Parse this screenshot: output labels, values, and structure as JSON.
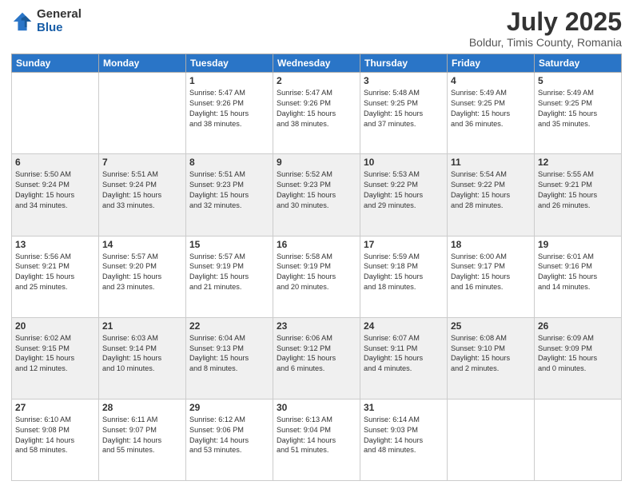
{
  "logo": {
    "general": "General",
    "blue": "Blue"
  },
  "title": "July 2025",
  "subtitle": "Boldur, Timis County, Romania",
  "weekdays": [
    "Sunday",
    "Monday",
    "Tuesday",
    "Wednesday",
    "Thursday",
    "Friday",
    "Saturday"
  ],
  "weeks": [
    [
      {
        "day": "",
        "info": ""
      },
      {
        "day": "",
        "info": ""
      },
      {
        "day": "1",
        "info": "Sunrise: 5:47 AM\nSunset: 9:26 PM\nDaylight: 15 hours\nand 38 minutes."
      },
      {
        "day": "2",
        "info": "Sunrise: 5:47 AM\nSunset: 9:26 PM\nDaylight: 15 hours\nand 38 minutes."
      },
      {
        "day": "3",
        "info": "Sunrise: 5:48 AM\nSunset: 9:25 PM\nDaylight: 15 hours\nand 37 minutes."
      },
      {
        "day": "4",
        "info": "Sunrise: 5:49 AM\nSunset: 9:25 PM\nDaylight: 15 hours\nand 36 minutes."
      },
      {
        "day": "5",
        "info": "Sunrise: 5:49 AM\nSunset: 9:25 PM\nDaylight: 15 hours\nand 35 minutes."
      }
    ],
    [
      {
        "day": "6",
        "info": "Sunrise: 5:50 AM\nSunset: 9:24 PM\nDaylight: 15 hours\nand 34 minutes."
      },
      {
        "day": "7",
        "info": "Sunrise: 5:51 AM\nSunset: 9:24 PM\nDaylight: 15 hours\nand 33 minutes."
      },
      {
        "day": "8",
        "info": "Sunrise: 5:51 AM\nSunset: 9:23 PM\nDaylight: 15 hours\nand 32 minutes."
      },
      {
        "day": "9",
        "info": "Sunrise: 5:52 AM\nSunset: 9:23 PM\nDaylight: 15 hours\nand 30 minutes."
      },
      {
        "day": "10",
        "info": "Sunrise: 5:53 AM\nSunset: 9:22 PM\nDaylight: 15 hours\nand 29 minutes."
      },
      {
        "day": "11",
        "info": "Sunrise: 5:54 AM\nSunset: 9:22 PM\nDaylight: 15 hours\nand 28 minutes."
      },
      {
        "day": "12",
        "info": "Sunrise: 5:55 AM\nSunset: 9:21 PM\nDaylight: 15 hours\nand 26 minutes."
      }
    ],
    [
      {
        "day": "13",
        "info": "Sunrise: 5:56 AM\nSunset: 9:21 PM\nDaylight: 15 hours\nand 25 minutes."
      },
      {
        "day": "14",
        "info": "Sunrise: 5:57 AM\nSunset: 9:20 PM\nDaylight: 15 hours\nand 23 minutes."
      },
      {
        "day": "15",
        "info": "Sunrise: 5:57 AM\nSunset: 9:19 PM\nDaylight: 15 hours\nand 21 minutes."
      },
      {
        "day": "16",
        "info": "Sunrise: 5:58 AM\nSunset: 9:19 PM\nDaylight: 15 hours\nand 20 minutes."
      },
      {
        "day": "17",
        "info": "Sunrise: 5:59 AM\nSunset: 9:18 PM\nDaylight: 15 hours\nand 18 minutes."
      },
      {
        "day": "18",
        "info": "Sunrise: 6:00 AM\nSunset: 9:17 PM\nDaylight: 15 hours\nand 16 minutes."
      },
      {
        "day": "19",
        "info": "Sunrise: 6:01 AM\nSunset: 9:16 PM\nDaylight: 15 hours\nand 14 minutes."
      }
    ],
    [
      {
        "day": "20",
        "info": "Sunrise: 6:02 AM\nSunset: 9:15 PM\nDaylight: 15 hours\nand 12 minutes."
      },
      {
        "day": "21",
        "info": "Sunrise: 6:03 AM\nSunset: 9:14 PM\nDaylight: 15 hours\nand 10 minutes."
      },
      {
        "day": "22",
        "info": "Sunrise: 6:04 AM\nSunset: 9:13 PM\nDaylight: 15 hours\nand 8 minutes."
      },
      {
        "day": "23",
        "info": "Sunrise: 6:06 AM\nSunset: 9:12 PM\nDaylight: 15 hours\nand 6 minutes."
      },
      {
        "day": "24",
        "info": "Sunrise: 6:07 AM\nSunset: 9:11 PM\nDaylight: 15 hours\nand 4 minutes."
      },
      {
        "day": "25",
        "info": "Sunrise: 6:08 AM\nSunset: 9:10 PM\nDaylight: 15 hours\nand 2 minutes."
      },
      {
        "day": "26",
        "info": "Sunrise: 6:09 AM\nSunset: 9:09 PM\nDaylight: 15 hours\nand 0 minutes."
      }
    ],
    [
      {
        "day": "27",
        "info": "Sunrise: 6:10 AM\nSunset: 9:08 PM\nDaylight: 14 hours\nand 58 minutes."
      },
      {
        "day": "28",
        "info": "Sunrise: 6:11 AM\nSunset: 9:07 PM\nDaylight: 14 hours\nand 55 minutes."
      },
      {
        "day": "29",
        "info": "Sunrise: 6:12 AM\nSunset: 9:06 PM\nDaylight: 14 hours\nand 53 minutes."
      },
      {
        "day": "30",
        "info": "Sunrise: 6:13 AM\nSunset: 9:04 PM\nDaylight: 14 hours\nand 51 minutes."
      },
      {
        "day": "31",
        "info": "Sunrise: 6:14 AM\nSunset: 9:03 PM\nDaylight: 14 hours\nand 48 minutes."
      },
      {
        "day": "",
        "info": ""
      },
      {
        "day": "",
        "info": ""
      }
    ]
  ],
  "accent_color": "#2a75c7"
}
